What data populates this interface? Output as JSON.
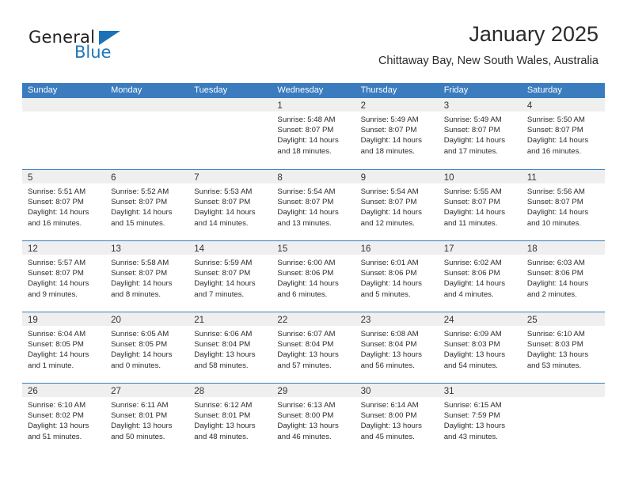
{
  "brand": {
    "name_top": "General",
    "name_bottom": "Blue",
    "triangle_color": "#1a72b8",
    "text_color": "#231f20",
    "blue_color": "#2077b8"
  },
  "header": {
    "title": "January 2025",
    "subtitle": "Chittaway Bay, New South Wales, Australia"
  },
  "theme": {
    "header_row_bg": "#3a7cbe",
    "header_row_text": "#ffffff",
    "day_band_bg": "#efefef",
    "week_separator": "#3a7cbe",
    "body_text": "#2b2b2b"
  },
  "weekdays": [
    "Sunday",
    "Monday",
    "Tuesday",
    "Wednesday",
    "Thursday",
    "Friday",
    "Saturday"
  ],
  "weeks": [
    [
      {
        "day": "",
        "empty": true,
        "sunrise": "",
        "sunset": "",
        "daylight1": "",
        "daylight2": ""
      },
      {
        "day": "",
        "empty": true,
        "sunrise": "",
        "sunset": "",
        "daylight1": "",
        "daylight2": ""
      },
      {
        "day": "",
        "empty": true,
        "sunrise": "",
        "sunset": "",
        "daylight1": "",
        "daylight2": ""
      },
      {
        "day": "1",
        "empty": false,
        "sunrise": "Sunrise: 5:48 AM",
        "sunset": "Sunset: 8:07 PM",
        "daylight1": "Daylight: 14 hours",
        "daylight2": "and 18 minutes."
      },
      {
        "day": "2",
        "empty": false,
        "sunrise": "Sunrise: 5:49 AM",
        "sunset": "Sunset: 8:07 PM",
        "daylight1": "Daylight: 14 hours",
        "daylight2": "and 18 minutes."
      },
      {
        "day": "3",
        "empty": false,
        "sunrise": "Sunrise: 5:49 AM",
        "sunset": "Sunset: 8:07 PM",
        "daylight1": "Daylight: 14 hours",
        "daylight2": "and 17 minutes."
      },
      {
        "day": "4",
        "empty": false,
        "sunrise": "Sunrise: 5:50 AM",
        "sunset": "Sunset: 8:07 PM",
        "daylight1": "Daylight: 14 hours",
        "daylight2": "and 16 minutes."
      }
    ],
    [
      {
        "day": "5",
        "empty": false,
        "sunrise": "Sunrise: 5:51 AM",
        "sunset": "Sunset: 8:07 PM",
        "daylight1": "Daylight: 14 hours",
        "daylight2": "and 16 minutes."
      },
      {
        "day": "6",
        "empty": false,
        "sunrise": "Sunrise: 5:52 AM",
        "sunset": "Sunset: 8:07 PM",
        "daylight1": "Daylight: 14 hours",
        "daylight2": "and 15 minutes."
      },
      {
        "day": "7",
        "empty": false,
        "sunrise": "Sunrise: 5:53 AM",
        "sunset": "Sunset: 8:07 PM",
        "daylight1": "Daylight: 14 hours",
        "daylight2": "and 14 minutes."
      },
      {
        "day": "8",
        "empty": false,
        "sunrise": "Sunrise: 5:54 AM",
        "sunset": "Sunset: 8:07 PM",
        "daylight1": "Daylight: 14 hours",
        "daylight2": "and 13 minutes."
      },
      {
        "day": "9",
        "empty": false,
        "sunrise": "Sunrise: 5:54 AM",
        "sunset": "Sunset: 8:07 PM",
        "daylight1": "Daylight: 14 hours",
        "daylight2": "and 12 minutes."
      },
      {
        "day": "10",
        "empty": false,
        "sunrise": "Sunrise: 5:55 AM",
        "sunset": "Sunset: 8:07 PM",
        "daylight1": "Daylight: 14 hours",
        "daylight2": "and 11 minutes."
      },
      {
        "day": "11",
        "empty": false,
        "sunrise": "Sunrise: 5:56 AM",
        "sunset": "Sunset: 8:07 PM",
        "daylight1": "Daylight: 14 hours",
        "daylight2": "and 10 minutes."
      }
    ],
    [
      {
        "day": "12",
        "empty": false,
        "sunrise": "Sunrise: 5:57 AM",
        "sunset": "Sunset: 8:07 PM",
        "daylight1": "Daylight: 14 hours",
        "daylight2": "and 9 minutes."
      },
      {
        "day": "13",
        "empty": false,
        "sunrise": "Sunrise: 5:58 AM",
        "sunset": "Sunset: 8:07 PM",
        "daylight1": "Daylight: 14 hours",
        "daylight2": "and 8 minutes."
      },
      {
        "day": "14",
        "empty": false,
        "sunrise": "Sunrise: 5:59 AM",
        "sunset": "Sunset: 8:07 PM",
        "daylight1": "Daylight: 14 hours",
        "daylight2": "and 7 minutes."
      },
      {
        "day": "15",
        "empty": false,
        "sunrise": "Sunrise: 6:00 AM",
        "sunset": "Sunset: 8:06 PM",
        "daylight1": "Daylight: 14 hours",
        "daylight2": "and 6 minutes."
      },
      {
        "day": "16",
        "empty": false,
        "sunrise": "Sunrise: 6:01 AM",
        "sunset": "Sunset: 8:06 PM",
        "daylight1": "Daylight: 14 hours",
        "daylight2": "and 5 minutes."
      },
      {
        "day": "17",
        "empty": false,
        "sunrise": "Sunrise: 6:02 AM",
        "sunset": "Sunset: 8:06 PM",
        "daylight1": "Daylight: 14 hours",
        "daylight2": "and 4 minutes."
      },
      {
        "day": "18",
        "empty": false,
        "sunrise": "Sunrise: 6:03 AM",
        "sunset": "Sunset: 8:06 PM",
        "daylight1": "Daylight: 14 hours",
        "daylight2": "and 2 minutes."
      }
    ],
    [
      {
        "day": "19",
        "empty": false,
        "sunrise": "Sunrise: 6:04 AM",
        "sunset": "Sunset: 8:05 PM",
        "daylight1": "Daylight: 14 hours",
        "daylight2": "and 1 minute."
      },
      {
        "day": "20",
        "empty": false,
        "sunrise": "Sunrise: 6:05 AM",
        "sunset": "Sunset: 8:05 PM",
        "daylight1": "Daylight: 14 hours",
        "daylight2": "and 0 minutes."
      },
      {
        "day": "21",
        "empty": false,
        "sunrise": "Sunrise: 6:06 AM",
        "sunset": "Sunset: 8:04 PM",
        "daylight1": "Daylight: 13 hours",
        "daylight2": "and 58 minutes."
      },
      {
        "day": "22",
        "empty": false,
        "sunrise": "Sunrise: 6:07 AM",
        "sunset": "Sunset: 8:04 PM",
        "daylight1": "Daylight: 13 hours",
        "daylight2": "and 57 minutes."
      },
      {
        "day": "23",
        "empty": false,
        "sunrise": "Sunrise: 6:08 AM",
        "sunset": "Sunset: 8:04 PM",
        "daylight1": "Daylight: 13 hours",
        "daylight2": "and 56 minutes."
      },
      {
        "day": "24",
        "empty": false,
        "sunrise": "Sunrise: 6:09 AM",
        "sunset": "Sunset: 8:03 PM",
        "daylight1": "Daylight: 13 hours",
        "daylight2": "and 54 minutes."
      },
      {
        "day": "25",
        "empty": false,
        "sunrise": "Sunrise: 6:10 AM",
        "sunset": "Sunset: 8:03 PM",
        "daylight1": "Daylight: 13 hours",
        "daylight2": "and 53 minutes."
      }
    ],
    [
      {
        "day": "26",
        "empty": false,
        "sunrise": "Sunrise: 6:10 AM",
        "sunset": "Sunset: 8:02 PM",
        "daylight1": "Daylight: 13 hours",
        "daylight2": "and 51 minutes."
      },
      {
        "day": "27",
        "empty": false,
        "sunrise": "Sunrise: 6:11 AM",
        "sunset": "Sunset: 8:01 PM",
        "daylight1": "Daylight: 13 hours",
        "daylight2": "and 50 minutes."
      },
      {
        "day": "28",
        "empty": false,
        "sunrise": "Sunrise: 6:12 AM",
        "sunset": "Sunset: 8:01 PM",
        "daylight1": "Daylight: 13 hours",
        "daylight2": "and 48 minutes."
      },
      {
        "day": "29",
        "empty": false,
        "sunrise": "Sunrise: 6:13 AM",
        "sunset": "Sunset: 8:00 PM",
        "daylight1": "Daylight: 13 hours",
        "daylight2": "and 46 minutes."
      },
      {
        "day": "30",
        "empty": false,
        "sunrise": "Sunrise: 6:14 AM",
        "sunset": "Sunset: 8:00 PM",
        "daylight1": "Daylight: 13 hours",
        "daylight2": "and 45 minutes."
      },
      {
        "day": "31",
        "empty": false,
        "sunrise": "Sunrise: 6:15 AM",
        "sunset": "Sunset: 7:59 PM",
        "daylight1": "Daylight: 13 hours",
        "daylight2": "and 43 minutes."
      },
      {
        "day": "",
        "empty": true,
        "sunrise": "",
        "sunset": "",
        "daylight1": "",
        "daylight2": ""
      }
    ]
  ]
}
